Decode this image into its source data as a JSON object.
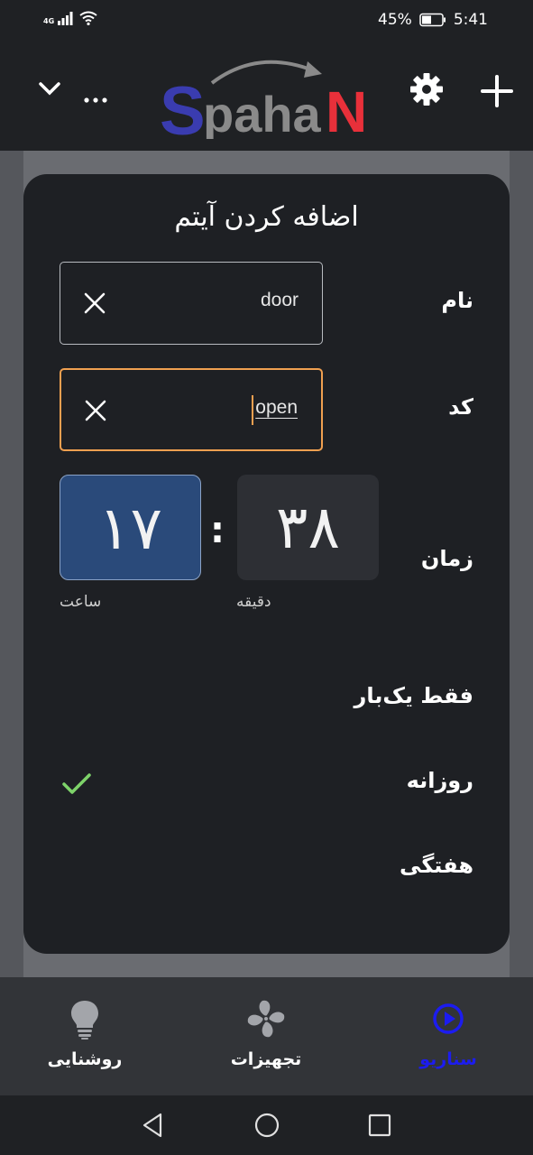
{
  "status_bar": {
    "network": "4G",
    "battery_percent": "45%",
    "time": "5:41"
  },
  "app_bar": {
    "logo_text": "SpahaN",
    "chevron": "chevron-down-icon",
    "more": "more-icon",
    "settings": "gear-icon",
    "add": "plus-icon"
  },
  "dialog": {
    "title": "اضافه کردن آیتم",
    "name_label": "نام",
    "name_value": "door",
    "code_label": "کد",
    "code_value": "open",
    "time_label": "زمان",
    "hour_value": "۱۷",
    "minute_value": "۳۸",
    "time_separator": ":",
    "hour_caption": "ساعت",
    "minute_caption": "دقیقه",
    "options": [
      {
        "label": "فقط یک‌بار",
        "selected": false
      },
      {
        "label": "روزانه",
        "selected": true
      },
      {
        "label": "هفتگی",
        "selected": false
      }
    ]
  },
  "bottom_nav": {
    "items": [
      {
        "label": "روشنایی",
        "icon": "lightbulb-icon",
        "active": false
      },
      {
        "label": "تجهیزات",
        "icon": "fan-icon",
        "active": false
      },
      {
        "label": "سناریو",
        "icon": "play-circle-icon",
        "active": true
      }
    ]
  },
  "colors": {
    "accent_focus": "#f0a050",
    "active_nav": "#1c1cf0",
    "check": "#7ed36a",
    "logo_blue": "#3a3cb0",
    "logo_red": "#e8303a"
  }
}
